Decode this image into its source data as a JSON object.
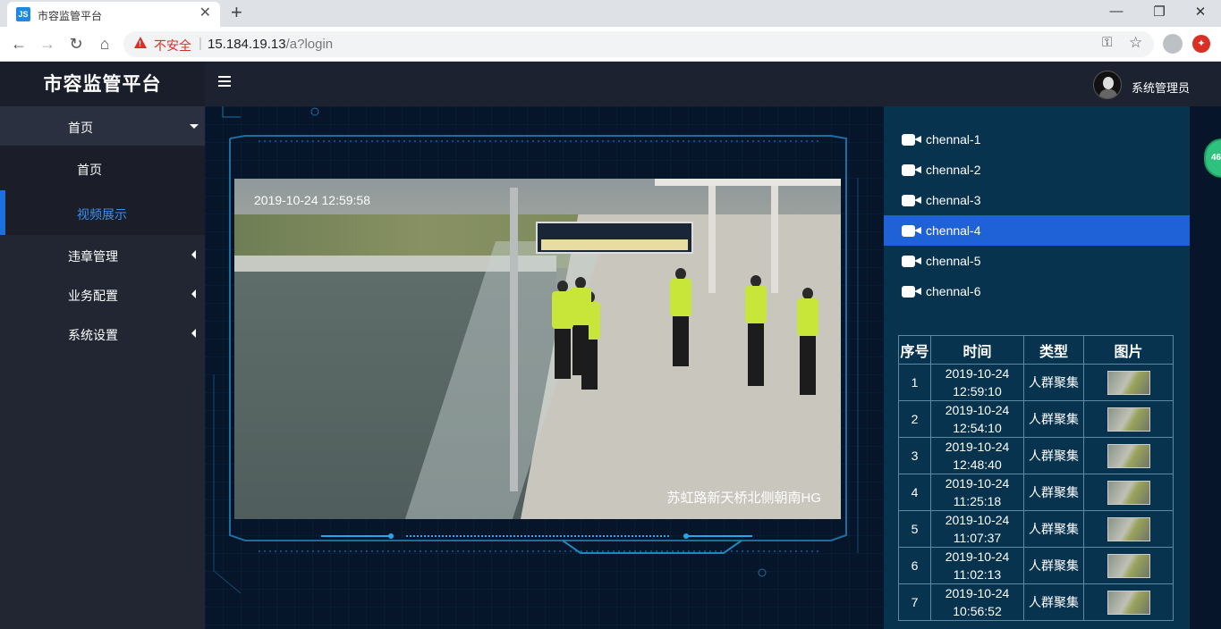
{
  "browser": {
    "tab_title": "市容监管平台",
    "tab_favicon": "JS",
    "new_tab_symbol": "+",
    "security_label": "不安全",
    "url_host": "15.184.19.13",
    "url_path": "/a?login"
  },
  "header": {
    "brand": "市容监管平台",
    "username": "系统管理员"
  },
  "sidebar": {
    "home": "首页",
    "sub_items": [
      "首页",
      "视频展示"
    ],
    "violation": "违章管理",
    "business": "业务配置",
    "system": "系统设置"
  },
  "video": {
    "timestamp": "2019-10-24 12:59:58",
    "location": "苏虹路新天桥北侧朝南HG"
  },
  "channels": {
    "items": [
      "chennal-1",
      "chennal-2",
      "chennal-3",
      "chennal-4",
      "chennal-5",
      "chennal-6"
    ],
    "active_index": 3
  },
  "events": {
    "headers": [
      "序号",
      "时间",
      "类型",
      "图片"
    ],
    "rows": [
      {
        "no": "1",
        "date": "2019-10-24",
        "time": "12:59:10",
        "type": "人群聚集"
      },
      {
        "no": "2",
        "date": "2019-10-24",
        "time": "12:54:10",
        "type": "人群聚集"
      },
      {
        "no": "3",
        "date": "2019-10-24",
        "time": "12:48:40",
        "type": "人群聚集"
      },
      {
        "no": "4",
        "date": "2019-10-24",
        "time": "11:25:18",
        "type": "人群聚集"
      },
      {
        "no": "5",
        "date": "2019-10-24",
        "time": "11:07:37",
        "type": "人群聚集"
      },
      {
        "no": "6",
        "date": "2019-10-24",
        "time": "11:02:13",
        "type": "人群聚集"
      },
      {
        "no": "7",
        "date": "2019-10-24",
        "time": "10:56:52",
        "type": "人群聚集"
      }
    ]
  },
  "floating_badge": "46",
  "colors": {
    "header_bg": "#1d2230",
    "sidebar_bg": "#222633",
    "main_bg": "#06152a",
    "panel_bg": "#08334f",
    "active_channel": "#1f62d8",
    "active_menu_text": "#3d8ff0"
  }
}
